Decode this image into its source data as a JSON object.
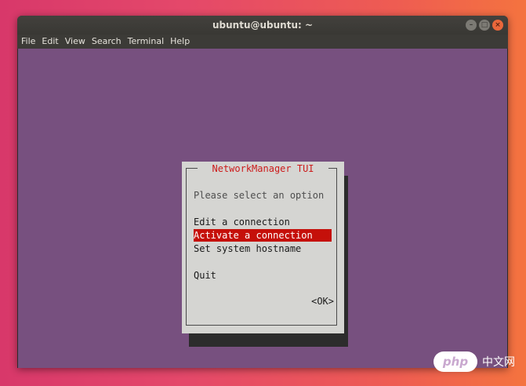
{
  "window": {
    "title": "ubuntu@ubuntu: ~",
    "buttons": {
      "minimize": "–",
      "maximize": "□",
      "close": "×"
    }
  },
  "menubar": {
    "items": [
      "File",
      "Edit",
      "View",
      "Search",
      "Terminal",
      "Help"
    ]
  },
  "dialog": {
    "title": "NetworkManager TUI",
    "prompt": "Please select an option",
    "options": [
      "Edit a connection",
      "Activate a connection",
      "Set system hostname",
      "Quit"
    ],
    "selected_option": "Activate a connection",
    "ok_label": "<OK>"
  },
  "watermark": {
    "logo": "php",
    "text": "中文网"
  },
  "colors": {
    "terminal_background": "#77507f",
    "dialog_background": "#d5d5d2",
    "dialog_title": "#cc1b1b",
    "selection": "#c5100a",
    "close_button": "#e9673b"
  }
}
